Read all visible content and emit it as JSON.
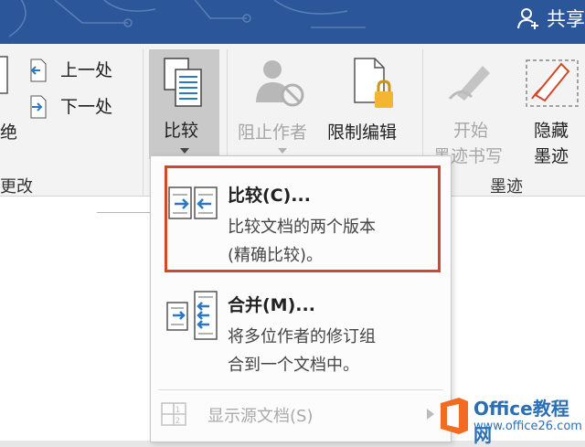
{
  "title_bar": {
    "share_label": "共享"
  },
  "ribbon": {
    "left_partial_1": "绝",
    "left_partial_2": "更改",
    "prev_label": "上一处",
    "next_label": "下一处",
    "compare_label": "比较",
    "block_authors_label": "阻止作者",
    "restrict_editing_label": "限制编辑",
    "start_inking_line1": "开始",
    "start_inking_line2": "墨迹书写",
    "hide_ink_line1": "隐藏",
    "hide_ink_line2": "墨迹",
    "ink_group_label": "墨迹"
  },
  "menu": {
    "items": [
      {
        "title": "比较(C)...",
        "desc_line1": "比较文档的两个版本",
        "desc_line2": "(精确比较)。"
      },
      {
        "title": "合并(M)...",
        "desc_line1": "将多位作者的修订组",
        "desc_line2": "合到一个文档中。"
      },
      {
        "title": "显示源文档(S)"
      }
    ]
  },
  "watermark": {
    "text1": "Office教程网",
    "text2": "www.office26.com"
  },
  "colors": {
    "titlebar": "#2b579a",
    "highlight": "#d24726",
    "watermark_orange": "#f26b22"
  }
}
